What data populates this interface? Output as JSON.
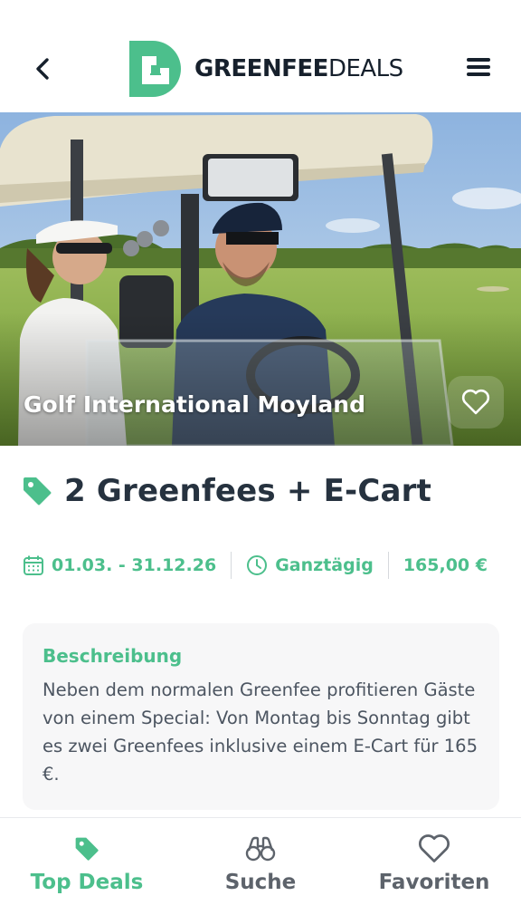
{
  "header": {
    "logo_bold": "GREENFEE",
    "logo_light": "DEALS",
    "back_icon": "chevron-left-icon",
    "menu_icon": "hamburger-menu-icon"
  },
  "hero": {
    "course_name": "Golf International Moyland",
    "favorite_icon": "heart-outline-icon"
  },
  "deal": {
    "title": "2 Greenfees + E-Cart",
    "title_icon": "tag-icon",
    "date_range": "01.03. - 31.12.26",
    "time": "Ganztägig",
    "price": "165,00 €"
  },
  "description": {
    "heading": "Beschreibung",
    "text": "Neben dem normalen Greenfee profitieren Gäste von einem Special: Von Montag bis Sonntag gibt es zwei Greenfees inklusive einem E-Cart für 165 €."
  },
  "bottom_nav": {
    "items": [
      {
        "label": "Top Deals",
        "icon": "tag-icon",
        "active": true
      },
      {
        "label": "Suche",
        "icon": "binoculars-icon",
        "active": false
      },
      {
        "label": "Favoriten",
        "icon": "heart-outline-icon",
        "active": false
      }
    ]
  },
  "colors": {
    "accent": "#4cbf8c",
    "text_dark": "#26323f",
    "card_bg": "#f7f7f8"
  }
}
